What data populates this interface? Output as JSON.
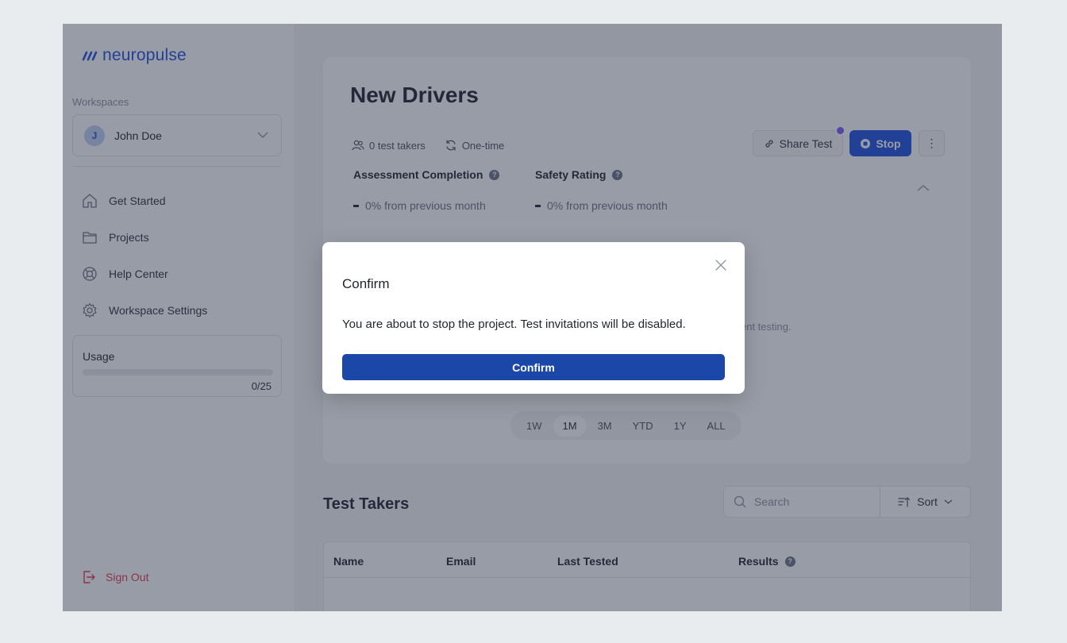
{
  "brand": {
    "name": "neuropulse",
    "color": "#1d4fe0"
  },
  "sidebar": {
    "workspaces_label": "Workspaces",
    "workspace": {
      "avatar_initial": "J",
      "name": "John Doe"
    },
    "items": [
      {
        "label": "Get Started",
        "icon": "home-icon"
      },
      {
        "label": "Projects",
        "icon": "folder-icon"
      },
      {
        "label": "Help Center",
        "icon": "lifebuoy-icon"
      },
      {
        "label": "Workspace Settings",
        "icon": "gear-icon"
      }
    ],
    "usage": {
      "title": "Usage",
      "count": "0/25",
      "progress": 0
    },
    "sign_out": "Sign Out"
  },
  "project": {
    "title": "New Drivers",
    "test_takers": "0 test takers",
    "frequency": "One-time",
    "share_label": "Share Test",
    "stop_label": "Stop",
    "more_label": "⋮",
    "stats": [
      {
        "label": "Assessment Completion",
        "change": "0% from previous month"
      },
      {
        "label": "Safety Rating",
        "change": "0% from previous month"
      }
    ],
    "empty_text_fragment": "ent testing.",
    "ranges": [
      "1W",
      "1M",
      "3M",
      "YTD",
      "1Y",
      "ALL"
    ],
    "active_range": "1M"
  },
  "test_takers": {
    "title": "Test Takers",
    "search_placeholder": "Search",
    "sort_label": "Sort",
    "columns": [
      "Name",
      "Email",
      "Last Tested",
      "Results"
    ]
  },
  "modal": {
    "title": "Confirm",
    "body": "You are about to stop the project. Test invitations will be disabled.",
    "confirm_label": "Confirm",
    "button_color": "#1b47a8"
  }
}
